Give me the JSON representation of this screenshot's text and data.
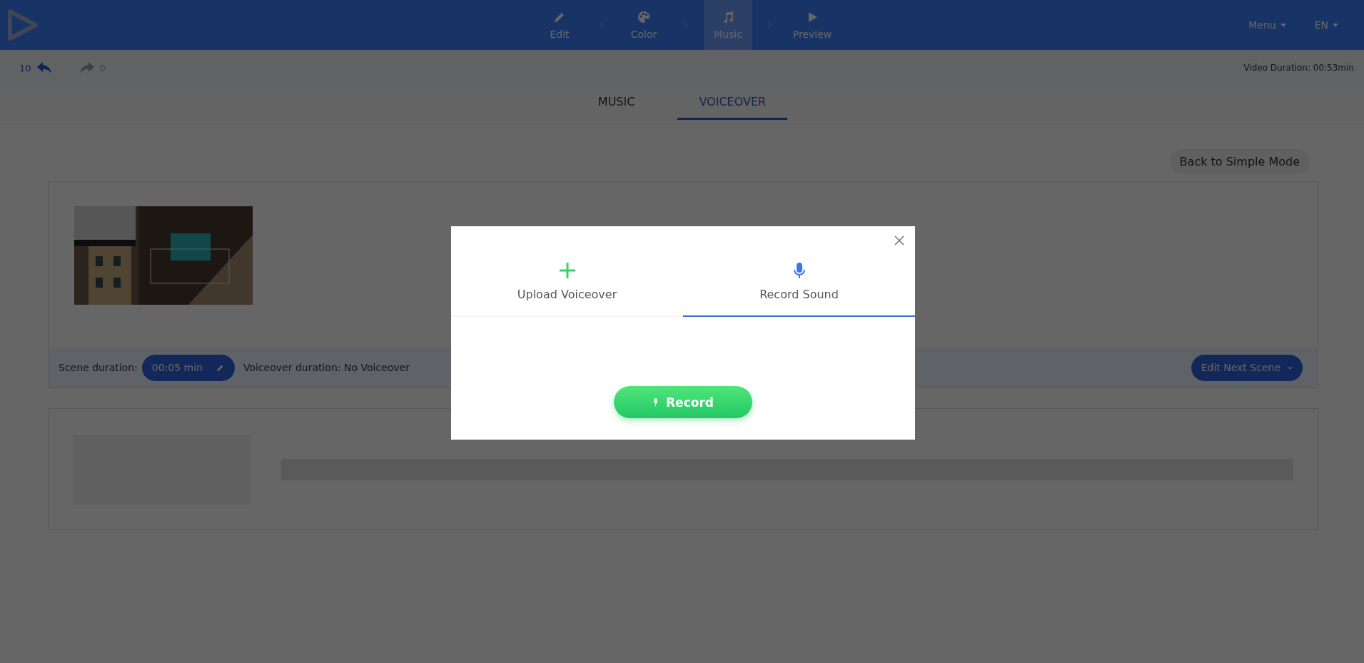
{
  "header": {
    "steps": [
      {
        "label": "Edit",
        "kind": "edit",
        "selected": false
      },
      {
        "label": "Color",
        "kind": "color",
        "selected": false
      },
      {
        "label": "Music",
        "kind": "music",
        "selected": true
      },
      {
        "label": "Preview",
        "kind": "preview",
        "selected": false
      }
    ],
    "menu": "Menu",
    "language": "EN"
  },
  "history": {
    "undo_count": "10",
    "redo_count": "0"
  },
  "video_duration": "Video Duration: 00:53min",
  "tabs": [
    {
      "label": "MUSIC",
      "selected": false
    },
    {
      "label": "VOICEOVER",
      "selected": true
    }
  ],
  "back_button": "Back to Simple Mode",
  "scene": {
    "duration_label": "Scene duration:",
    "duration": "00:05 min",
    "voiceover": "Voiceover duration: No Voiceover",
    "next_button": "Edit Next Scene"
  },
  "modal": {
    "tabs": [
      {
        "label": "Upload Voiceover",
        "kind": "upload",
        "selected": false
      },
      {
        "label": "Record Sound",
        "kind": "record",
        "selected": true
      }
    ],
    "record_button": "Record"
  }
}
